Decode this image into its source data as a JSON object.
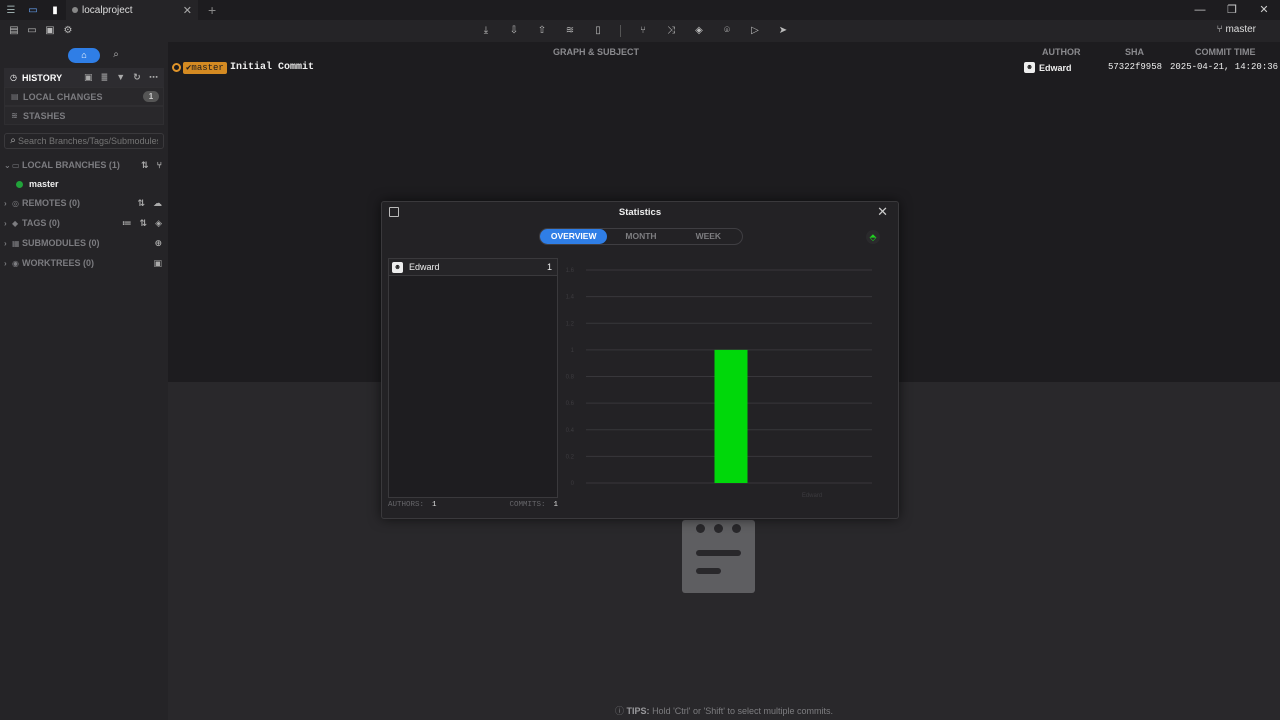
{
  "titlebar": {
    "tab_label": "localproject",
    "controls": [
      "—",
      "❐",
      "✕"
    ]
  },
  "toolbar": {
    "current_branch": "master"
  },
  "sidebar": {
    "history": "HISTORY",
    "local_changes": "LOCAL CHANGES",
    "local_changes_count": "1",
    "stashes": "STASHES",
    "search_placeholder": "Search Branches/Tags/Submodules",
    "local_branches": "LOCAL BRANCHES (1)",
    "branch_master": "master",
    "remotes": "REMOTES (0)",
    "tags": "TAGS (0)",
    "submodules": "SUBMODULES (0)",
    "worktrees": "WORKTREES (0)"
  },
  "commits": {
    "headers": {
      "graph": "GRAPH & SUBJECT",
      "author": "AUTHOR",
      "sha": "SHA",
      "time": "COMMIT TIME"
    },
    "rows": [
      {
        "ref": "master",
        "subject": "Initial Commit",
        "author": "Edward",
        "sha": "57322f9958",
        "time": "2025-04-21, 14:20:36"
      }
    ]
  },
  "tips": {
    "label": "TIPS:",
    "text": "Hold 'Ctrl' or 'Shift' to select multiple commits."
  },
  "dialog": {
    "title": "Statistics",
    "tabs": [
      "OVERVIEW",
      "MONTH",
      "WEEK"
    ],
    "authors": [
      {
        "name": "Edward",
        "count": "1"
      }
    ],
    "footer": {
      "authors_label": "AUTHORS:",
      "authors_value": "1",
      "commits_label": "COMMITS:",
      "commits_value": "1"
    }
  },
  "colors": {
    "accent": "#2f7ee6",
    "bar": "#00d80a",
    "ref_tag": "#d48a22"
  },
  "chart_data": {
    "type": "bar",
    "categories": [
      "Edward"
    ],
    "values": [
      1
    ],
    "ylim": [
      0,
      1.6
    ],
    "yticks": [
      "0",
      "0.2",
      "0.4",
      "0.6",
      "0.8",
      "1",
      "1.2",
      "1.4",
      "1.6"
    ],
    "xtick_label": "Edward",
    "grid": true,
    "bar_color": "#00d80a"
  }
}
